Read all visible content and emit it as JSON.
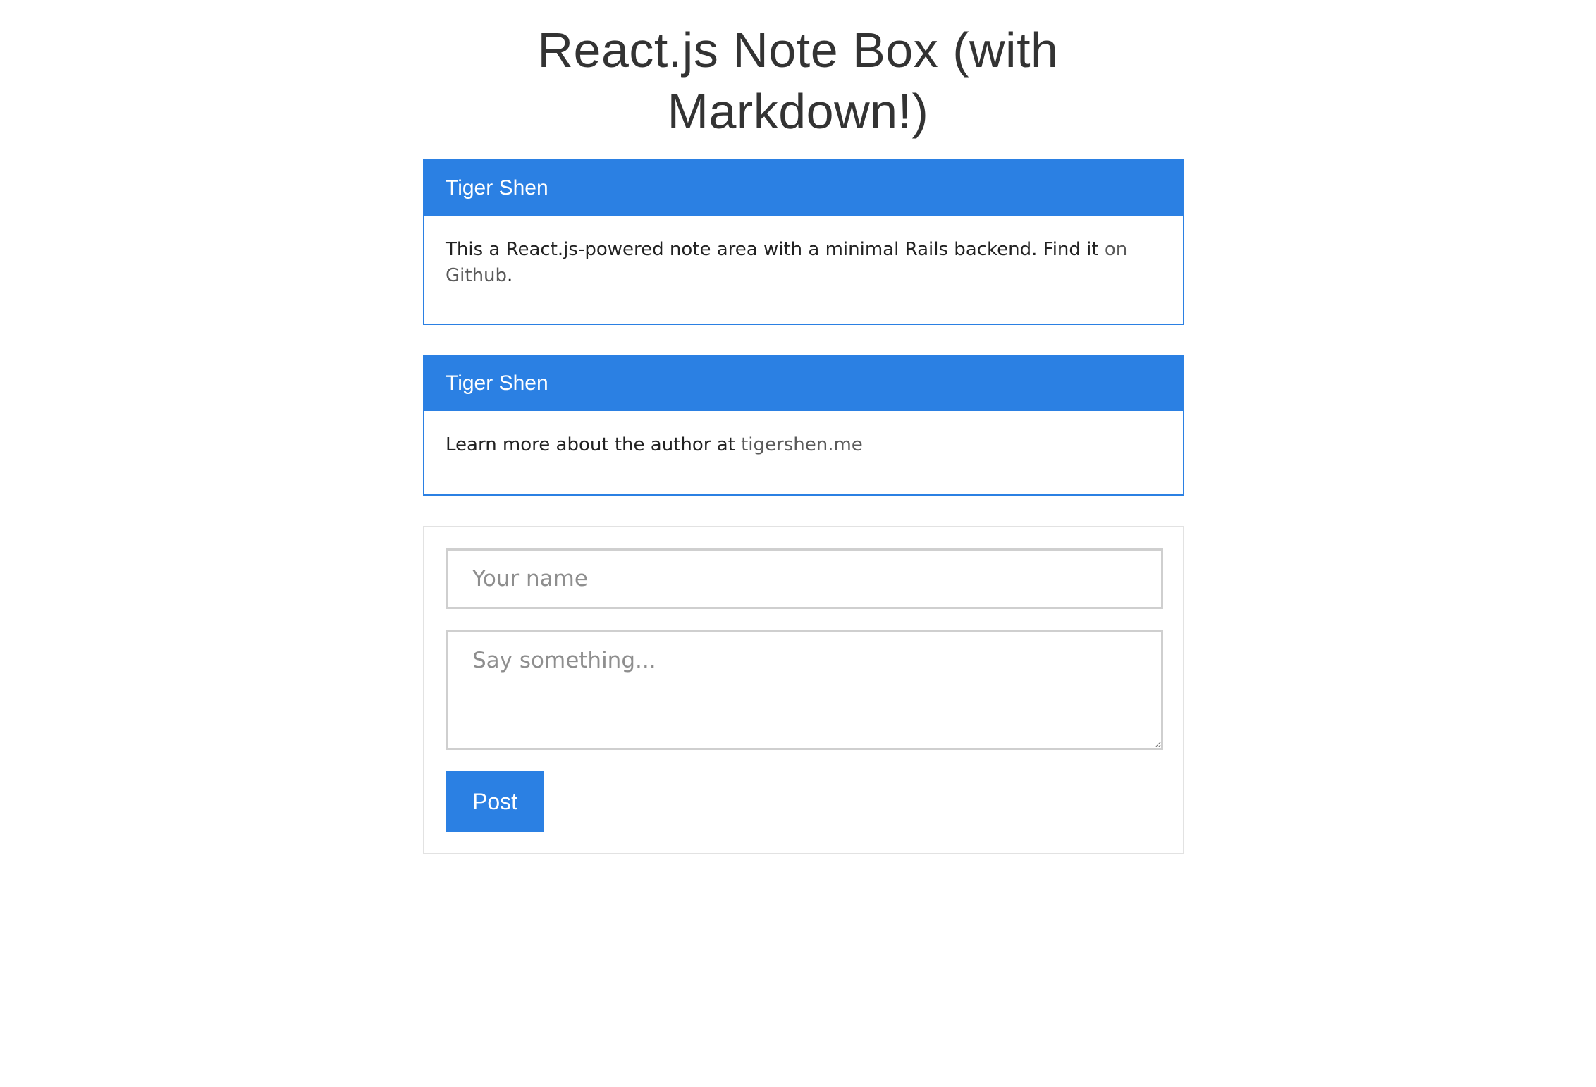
{
  "page": {
    "title": "React.js Note Box (with Markdown!)"
  },
  "notes": [
    {
      "author": "Tiger Shen",
      "text_before": "This a React.js-powered note area with a minimal Rails backend. Find it ",
      "link_text": "on Github",
      "text_after": "."
    },
    {
      "author": "Tiger Shen",
      "text_before": "Learn more about the author at ",
      "link_text": "tigershen.me",
      "text_after": ""
    }
  ],
  "form": {
    "name_placeholder": "Your name",
    "name_value": "",
    "text_placeholder": "Say something...",
    "text_value": "",
    "post_label": "Post"
  },
  "colors": {
    "accent": "#2b80e3",
    "link": "#5a5a5a",
    "form_border": "#e2e2e2"
  }
}
